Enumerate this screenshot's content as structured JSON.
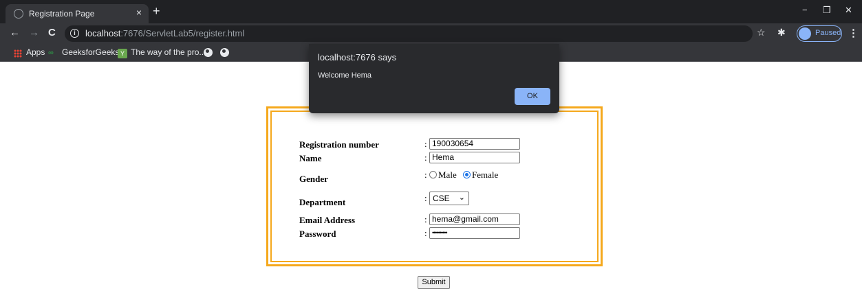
{
  "browser": {
    "tab": {
      "title": "Registration Page",
      "close": "×"
    },
    "new_tab": "+",
    "window_controls": {
      "minimize": "−",
      "restore": "❐",
      "close": "✕"
    },
    "nav": {
      "back": "←",
      "forward": "→",
      "reload": "C"
    },
    "address": {
      "host": "localhost",
      "rest": ":7676/ServletLab5/register.html"
    },
    "star": "☆",
    "extensions": "✱",
    "profile_label": "Paused",
    "menu": "⋮",
    "bookmarks": [
      {
        "label": "Apps",
        "icon": "apps-grid-icon"
      },
      {
        "label": "GeeksforGeeks",
        "icon": "gfg-icon"
      },
      {
        "label": "The way of the pro...",
        "icon": "bookmark-favicon-icon"
      }
    ],
    "icon_glyphs": {
      "gfg": "∞",
      "way": "Y"
    }
  },
  "dialog": {
    "title": "localhost:7676 says",
    "message": "Welcome Hema",
    "ok_label": "OK"
  },
  "form": {
    "colon": ":",
    "labels": {
      "registration_number": "Registration number",
      "name": "Name",
      "gender": "Gender",
      "department": "Department",
      "email": "Email Address",
      "password": "Password"
    },
    "values": {
      "registration_number": "190030654",
      "name": "Hema",
      "email": "hema@gmail.com",
      "password_masked": "••••••••••"
    },
    "gender_options": [
      {
        "label": "Male",
        "checked": false
      },
      {
        "label": "Female",
        "checked": true
      }
    ],
    "department_selected": "CSE",
    "select_arrow": "⌄",
    "submit_label": "Submit"
  },
  "colors": {
    "frame_border": "#f5a81c",
    "dialog_bg": "#292a2d",
    "ok_button": "#8ab4f8",
    "chrome_dark": "#202124",
    "chrome_toolbar": "#35363a"
  }
}
